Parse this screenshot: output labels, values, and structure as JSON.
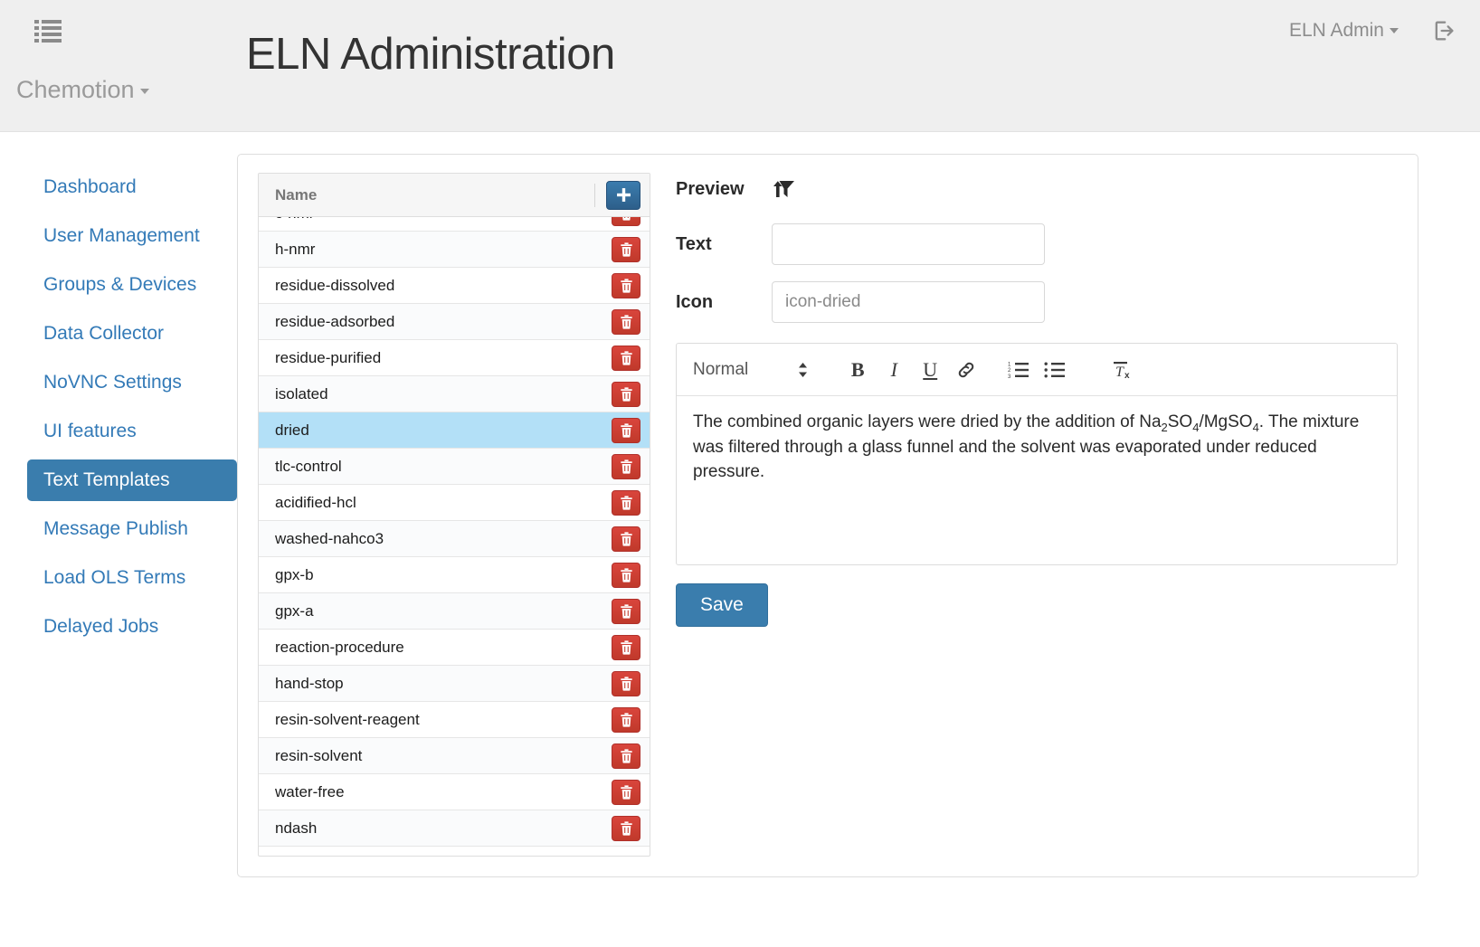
{
  "navbar": {
    "list_icon": "list-icon",
    "brand": "Chemotion",
    "page_title": "ELN Administration",
    "user_label": "ELN Admin",
    "logout_icon": "logout-icon"
  },
  "sidebar": {
    "items": [
      {
        "label": "Dashboard",
        "active": false
      },
      {
        "label": "User Management",
        "active": false
      },
      {
        "label": "Groups & Devices",
        "active": false
      },
      {
        "label": "Data Collector",
        "active": false
      },
      {
        "label": "NoVNC Settings",
        "active": false
      },
      {
        "label": "UI features",
        "active": false
      },
      {
        "label": "Text Templates",
        "active": true
      },
      {
        "label": "Message Publish",
        "active": false
      },
      {
        "label": "Load OLS Terms",
        "active": false
      },
      {
        "label": "Delayed Jobs",
        "active": false
      }
    ]
  },
  "list_panel": {
    "column_header": "Name",
    "add_button_label": "+",
    "delete_button_icon": "trash-icon",
    "rows": [
      {
        "name": "c-nmr",
        "selected": false,
        "clipped": true
      },
      {
        "name": "h-nmr",
        "selected": false
      },
      {
        "name": "residue-dissolved",
        "selected": false
      },
      {
        "name": "residue-adsorbed",
        "selected": false
      },
      {
        "name": "residue-purified",
        "selected": false
      },
      {
        "name": "isolated",
        "selected": false
      },
      {
        "name": "dried",
        "selected": true
      },
      {
        "name": "tlc-control",
        "selected": false
      },
      {
        "name": "acidified-hcl",
        "selected": false
      },
      {
        "name": "washed-nahco3",
        "selected": false
      },
      {
        "name": "gpx-b",
        "selected": false
      },
      {
        "name": "gpx-a",
        "selected": false
      },
      {
        "name": "reaction-procedure",
        "selected": false
      },
      {
        "name": "hand-stop",
        "selected": false
      },
      {
        "name": "resin-solvent-reagent",
        "selected": false
      },
      {
        "name": "resin-solvent",
        "selected": false
      },
      {
        "name": "water-free",
        "selected": false
      },
      {
        "name": "ndash",
        "selected": false
      }
    ]
  },
  "form": {
    "preview_label": "Preview",
    "preview_icon": "funnel-arrow-icon",
    "text_label": "Text",
    "text_value": "",
    "text_placeholder": "",
    "icon_label": "Icon",
    "icon_value": "",
    "icon_placeholder": "icon-dried",
    "save_label": "Save"
  },
  "editor": {
    "style_select": "Normal",
    "tools": [
      {
        "name": "bold-icon",
        "glyph": "B"
      },
      {
        "name": "italic-icon",
        "glyph": "I"
      },
      {
        "name": "underline-icon",
        "glyph": "U"
      },
      {
        "name": "link-icon",
        "glyph": "link"
      },
      {
        "name": "ordered-list-icon",
        "glyph": "ol"
      },
      {
        "name": "unordered-list-icon",
        "glyph": "ul"
      },
      {
        "name": "clear-formatting-icon",
        "glyph": "Tx"
      }
    ],
    "content_parts": [
      {
        "t": "The combined organic layers were dried by the addition of Na"
      },
      {
        "sub": "2"
      },
      {
        "t": "SO"
      },
      {
        "sub": "4"
      },
      {
        "t": "/MgSO"
      },
      {
        "sub": "4"
      },
      {
        "t": ". The mixture was filtered through a glass funnel and the solvent was evaporated under reduced pressure."
      }
    ],
    "content_plain": "The combined organic layers were dried by the addition of Na2SO4/MgSO4. The mixture was filtered through a glass funnel and the solvent was evaporated under reduced pressure."
  },
  "colors": {
    "accent_blue": "#337ab7",
    "active_blue": "#3a7dad",
    "selected_row": "#b3e0f7",
    "danger_red": "#c0392b",
    "navbar_bg": "#efefef"
  }
}
